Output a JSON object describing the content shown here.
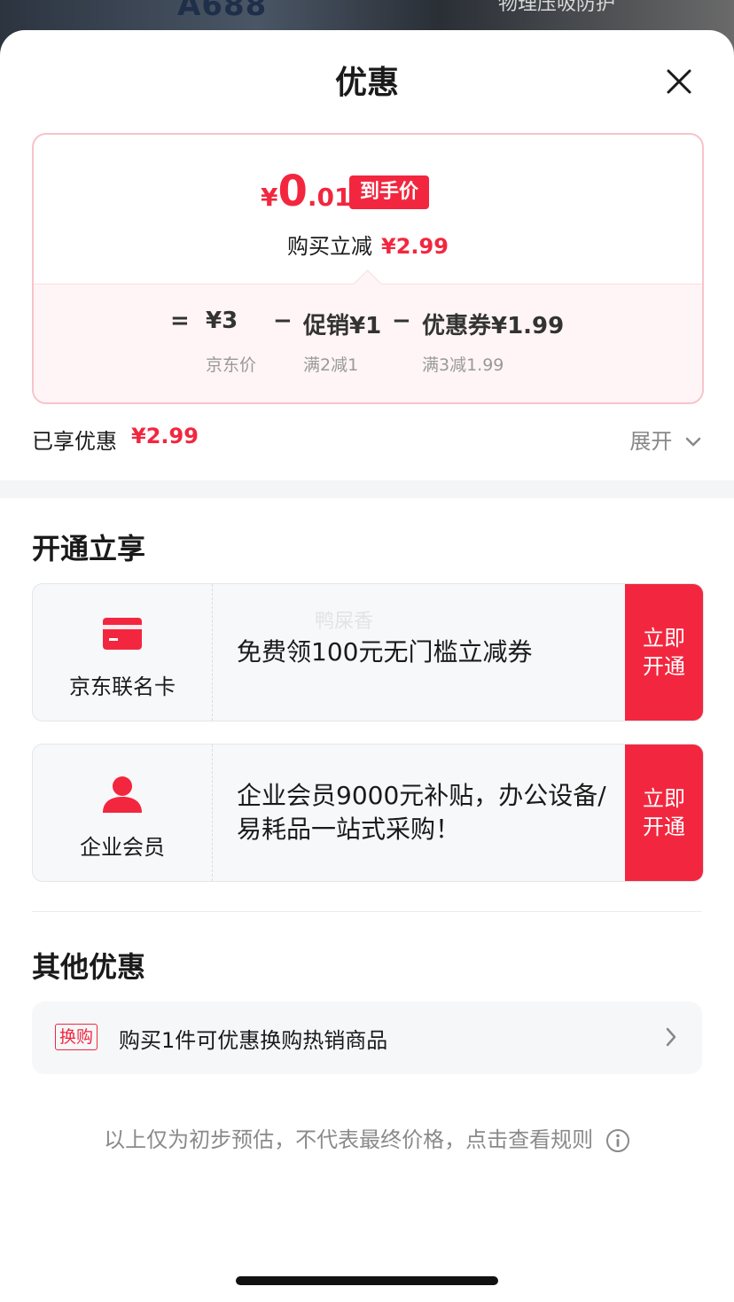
{
  "backdrop": {
    "left_text": "A688",
    "right_text": "物理压吸防护"
  },
  "sheet": {
    "title": "优惠",
    "close_icon": "close-icon"
  },
  "price_card": {
    "final": {
      "symbol": "¥",
      "integer": "0",
      "decimal": ".01",
      "tag": "到手价"
    },
    "reduce": {
      "label": "购买立减",
      "amount": "¥2.99"
    },
    "formula": {
      "equals": "=",
      "jd_price": "¥3",
      "jd_price_label": "京东价",
      "minus1": "−",
      "promo": "促销¥1",
      "promo_note": "满2减1",
      "minus2": "−",
      "coupon": "优惠券¥1.99",
      "coupon_note": "满3减1.99"
    }
  },
  "summary": {
    "label": "已享优惠",
    "amount": "¥2.99",
    "expand": "展开"
  },
  "open_section": {
    "title": "开通立享",
    "cards": [
      {
        "name": "京东联名卡",
        "icon": "card-icon",
        "desc": "免费领100元无门槛立减券",
        "button": "立即开通",
        "watermark": "鸭屎香"
      },
      {
        "name": "企业会员",
        "icon": "user-icon",
        "desc": "企业会员9000元补贴，办公设备/易耗品一站式采购！",
        "button": "立即开通"
      }
    ]
  },
  "other_section": {
    "title": "其他优惠",
    "item": {
      "tag": "换购",
      "text": "购买1件可优惠换购热销商品"
    }
  },
  "footnote": "以上仅为初步预估，不代表最终价格，点击查看规则",
  "colors": {
    "accent": "#f2273f",
    "card_border": "#f7c3cb",
    "muted": "#8a8a8a"
  }
}
